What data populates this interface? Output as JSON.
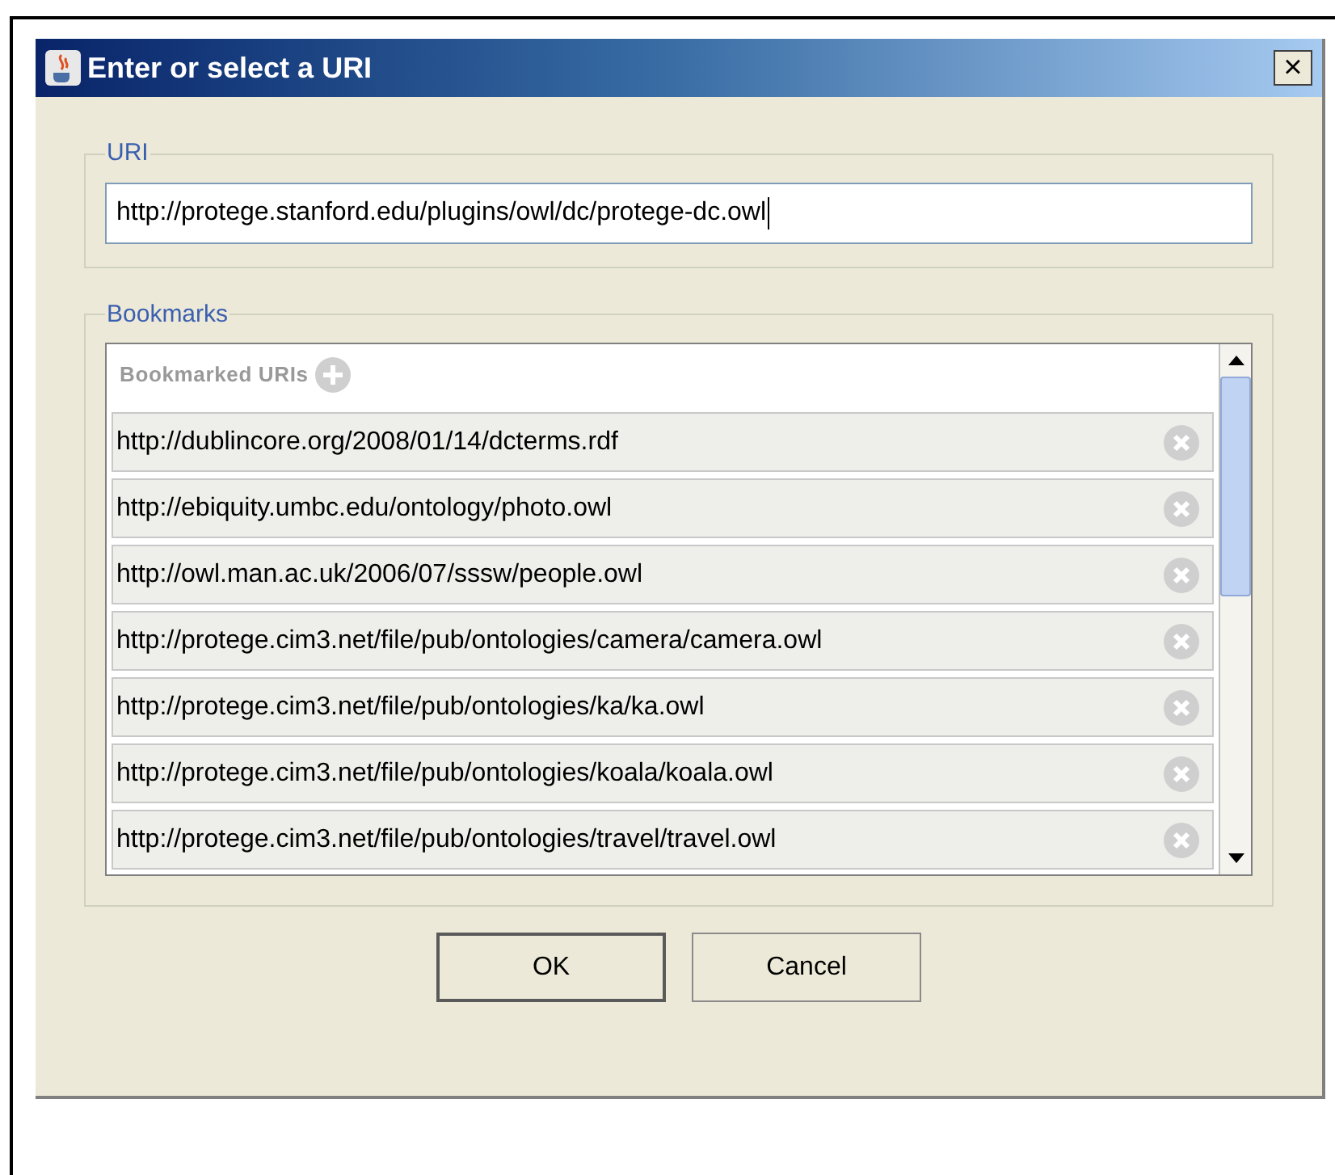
{
  "window": {
    "title": "Enter or select a URI",
    "close": "×"
  },
  "uri": {
    "legend": "URI",
    "value": "http://protege.stanford.edu/plugins/owl/dc/protege-dc.owl"
  },
  "bookmarks": {
    "legend": "Bookmarks",
    "header": "Bookmarked URIs",
    "items": [
      {
        "url": "http://dublincore.org/2008/01/14/dcterms.rdf"
      },
      {
        "url": "http://ebiquity.umbc.edu/ontology/photo.owl"
      },
      {
        "url": "http://owl.man.ac.uk/2006/07/sssw/people.owl"
      },
      {
        "url": "http://protege.cim3.net/file/pub/ontologies/camera/camera.owl"
      },
      {
        "url": "http://protege.cim3.net/file/pub/ontologies/ka/ka.owl"
      },
      {
        "url": "http://protege.cim3.net/file/pub/ontologies/koala/koala.owl"
      },
      {
        "url": "http://protege.cim3.net/file/pub/ontologies/travel/travel.owl"
      }
    ]
  },
  "buttons": [
    {
      "label": "OK",
      "default": true
    },
    {
      "label": "Cancel",
      "default": false
    }
  ]
}
